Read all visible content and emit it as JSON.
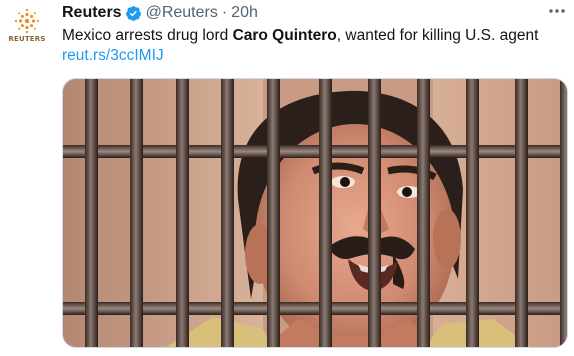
{
  "tweet": {
    "avatar_text": "REUTERS",
    "display_name": "Reuters",
    "handle": "@Reuters",
    "separator": "·",
    "time": "20h",
    "text_before": "Mexico arrests drug lord ",
    "text_bold": "Caro Quintero",
    "text_after": ", wanted for killing U.S. agent",
    "link": "reut.rs/3ccIMIJ"
  },
  "colors": {
    "link": "#1d9bf0",
    "verified": "#1d9bf0",
    "muted": "#536471",
    "text": "#0f1419"
  },
  "icons": {
    "avatar": "reuters-logo-icon",
    "verified": "verified-badge-icon",
    "more": "more-options-icon"
  }
}
